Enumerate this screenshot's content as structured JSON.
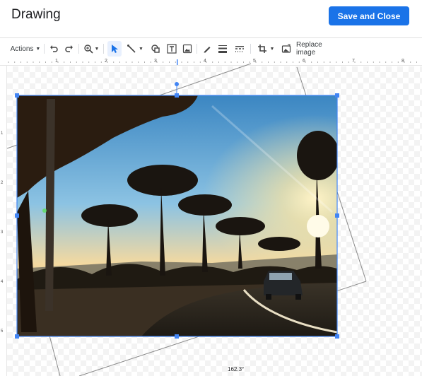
{
  "header": {
    "title": "Drawing",
    "save_label": "Save and Close"
  },
  "toolbar": {
    "actions_label": "Actions",
    "replace_image_label": "Replace image",
    "icons": [
      "undo-icon",
      "redo-icon",
      "zoom-icon",
      "select-icon",
      "line-icon",
      "shape-icon",
      "text-box-icon",
      "image-icon",
      "pen-icon",
      "line-weight-icon",
      "line-dash-icon",
      "crop-icon",
      "replace-image-icon"
    ]
  },
  "ruler": {
    "labels": [
      "1",
      "2",
      "3",
      "4",
      "5",
      "6",
      "7",
      "8"
    ]
  },
  "vertical_ruler": {
    "labels": [
      "1",
      "2",
      "3",
      "4",
      "5"
    ]
  },
  "image": {
    "description_icon": "photo",
    "rotation_label": "162.3°"
  },
  "colors": {
    "accent": "#1a73e8",
    "selection": "#4285f4",
    "sky_top": "#3b86c2",
    "sun": "#fff4c8"
  }
}
